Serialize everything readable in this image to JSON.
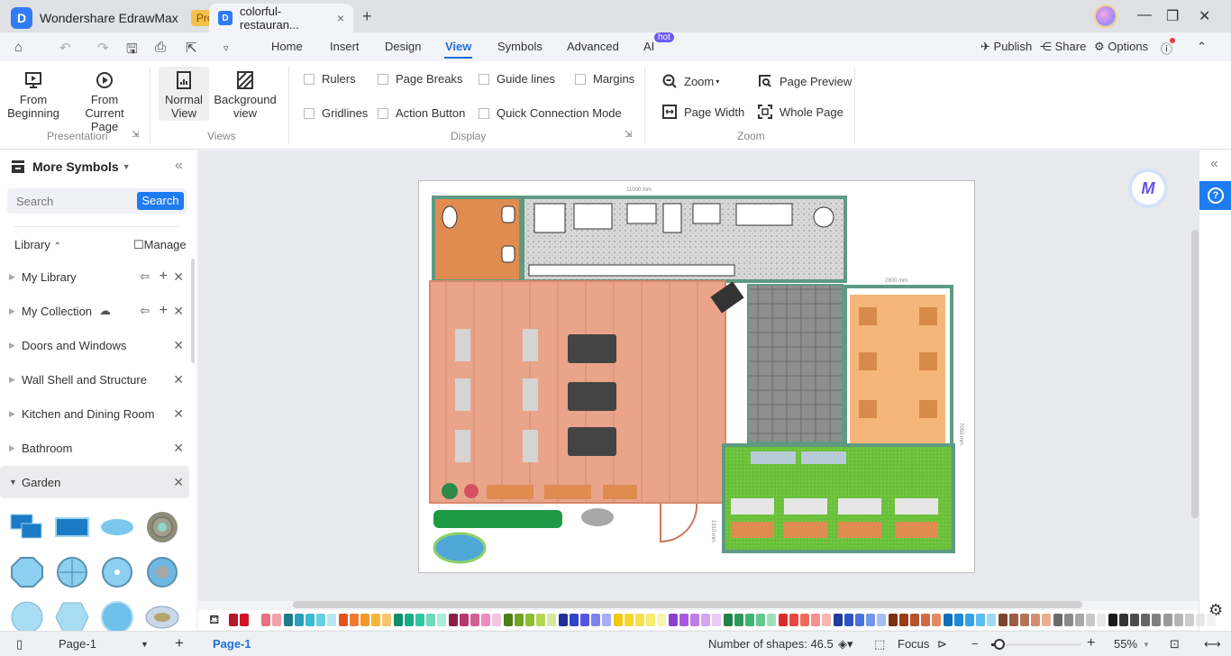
{
  "app": {
    "name": "Wondershare EdrawMax",
    "badge": "Pro",
    "logo_glyph": "D"
  },
  "tabs": [
    {
      "label": "colorful-restauran...",
      "close": "×"
    }
  ],
  "new_tab": "+",
  "window_controls": {
    "minimize": "—",
    "maximize": "❐",
    "close": "✕"
  },
  "menu": {
    "items": [
      "Home",
      "Insert",
      "Design",
      "View",
      "Symbols",
      "Advanced",
      "AI"
    ],
    "active": "View",
    "ai_badge": "hot",
    "right": {
      "publish": "Publish",
      "share": "Share",
      "options": "Options"
    }
  },
  "ribbon": {
    "presentation": {
      "label": "Presentation",
      "from_beginning": [
        "From",
        "Beginning"
      ],
      "from_current": [
        "From Current",
        "Page"
      ]
    },
    "views": {
      "label": "Views",
      "normal": [
        "Normal",
        "View"
      ],
      "background": [
        "Background",
        "view"
      ]
    },
    "display": {
      "label": "Display",
      "checkboxes": [
        {
          "label": "Rulers",
          "checked": false
        },
        {
          "label": "Page Breaks",
          "checked": false
        },
        {
          "label": "Guide lines",
          "checked": false
        },
        {
          "label": "Margins",
          "checked": false
        },
        {
          "label": "Gridlines",
          "checked": false
        },
        {
          "label": "Action Button",
          "checked": false
        },
        {
          "label": "Quick Connection Mode",
          "checked": false
        }
      ]
    },
    "zoom": {
      "label": "Zoom",
      "zoom": "Zoom",
      "page_preview": "Page Preview",
      "page_width": "Page Width",
      "whole_page": "Whole Page"
    }
  },
  "sidebar": {
    "title": "More Symbols",
    "search_placeholder": "Search",
    "search_button": "Search",
    "library_label": "Library",
    "manage": "Manage",
    "libraries": [
      {
        "label": "My Library",
        "expanded": false
      },
      {
        "label": "My Collection",
        "expanded": false
      },
      {
        "label": "Doors and Windows",
        "expanded": false
      },
      {
        "label": "Wall Shell and Structure",
        "expanded": false
      },
      {
        "label": "Kitchen and Dining Room",
        "expanded": false
      },
      {
        "label": "Bathroom",
        "expanded": false
      },
      {
        "label": "Garden",
        "expanded": true
      }
    ]
  },
  "drawing": {
    "dimension_top": "11000 mm",
    "dimension_right_top": "2800 mm",
    "dimension_right": "7050 mm",
    "dimension_bottom": "1310 mm"
  },
  "palette": [
    "#b5172a",
    "#d0142a",
    "#e8707f",
    "#f2a0ab",
    "#1f7a8c",
    "#2a9fb8",
    "#3bbbd0",
    "#62d0e0",
    "#b7e7f2",
    "#e3531e",
    "#f07a32",
    "#f5982c",
    "#f7b637",
    "#f8c66b",
    "#0f8f6e",
    "#18ae85",
    "#2ec7a0",
    "#6fd9bd",
    "#a8ecd9",
    "#8d1e4a",
    "#b4386e",
    "#d35f93",
    "#ee8dbb",
    "#f5c6dd",
    "#4f7d17",
    "#6fa322",
    "#8cbf2e",
    "#b3d653",
    "#d6e99a",
    "#1f2f9e",
    "#2f44c8",
    "#5256e0",
    "#7b83ee",
    "#a8aef5",
    "#f2c70f",
    "#f5d630",
    "#f5e04d",
    "#f7ec6f",
    "#faf4b0",
    "#8a3fd0",
    "#a85be0",
    "#c07ce8",
    "#d6a3f0",
    "#e9c9f6",
    "#22804a",
    "#2d9a5c",
    "#3fb572",
    "#62c98d",
    "#9edfb7",
    "#d92b2b",
    "#e8473f",
    "#f06a5d",
    "#f5918a",
    "#f8b8b0",
    "#203c9a",
    "#2e55c6",
    "#4a73df",
    "#7595ea",
    "#a5bdf4",
    "#7a2f10",
    "#9a3d15",
    "#b8502a",
    "#d06a40",
    "#e58b62",
    "#0e6fb8",
    "#1c8ad6",
    "#34a3e6",
    "#5ebdf0",
    "#9fd8f7",
    "#7a4530",
    "#9a5c42",
    "#b57456",
    "#d09070",
    "#e8b090",
    "#6a6a6a",
    "#8a8a8a",
    "#a8a8a8",
    "#c8c8c8",
    "#e8e8e8",
    "#1a1a1a",
    "#333333",
    "#4d4d4d",
    "#666666",
    "#808080",
    "#999999",
    "#b3b3b3",
    "#cccccc",
    "#e6e6e6",
    "#f2f2f2"
  ],
  "statusbar": {
    "page_selector": "Page-1",
    "add_page": "+",
    "active_page": "Page-1",
    "shape_count": "Number of shapes: 46.5",
    "focus": "Focus",
    "zoom_value": "55%",
    "zoom_level": 0.55
  }
}
